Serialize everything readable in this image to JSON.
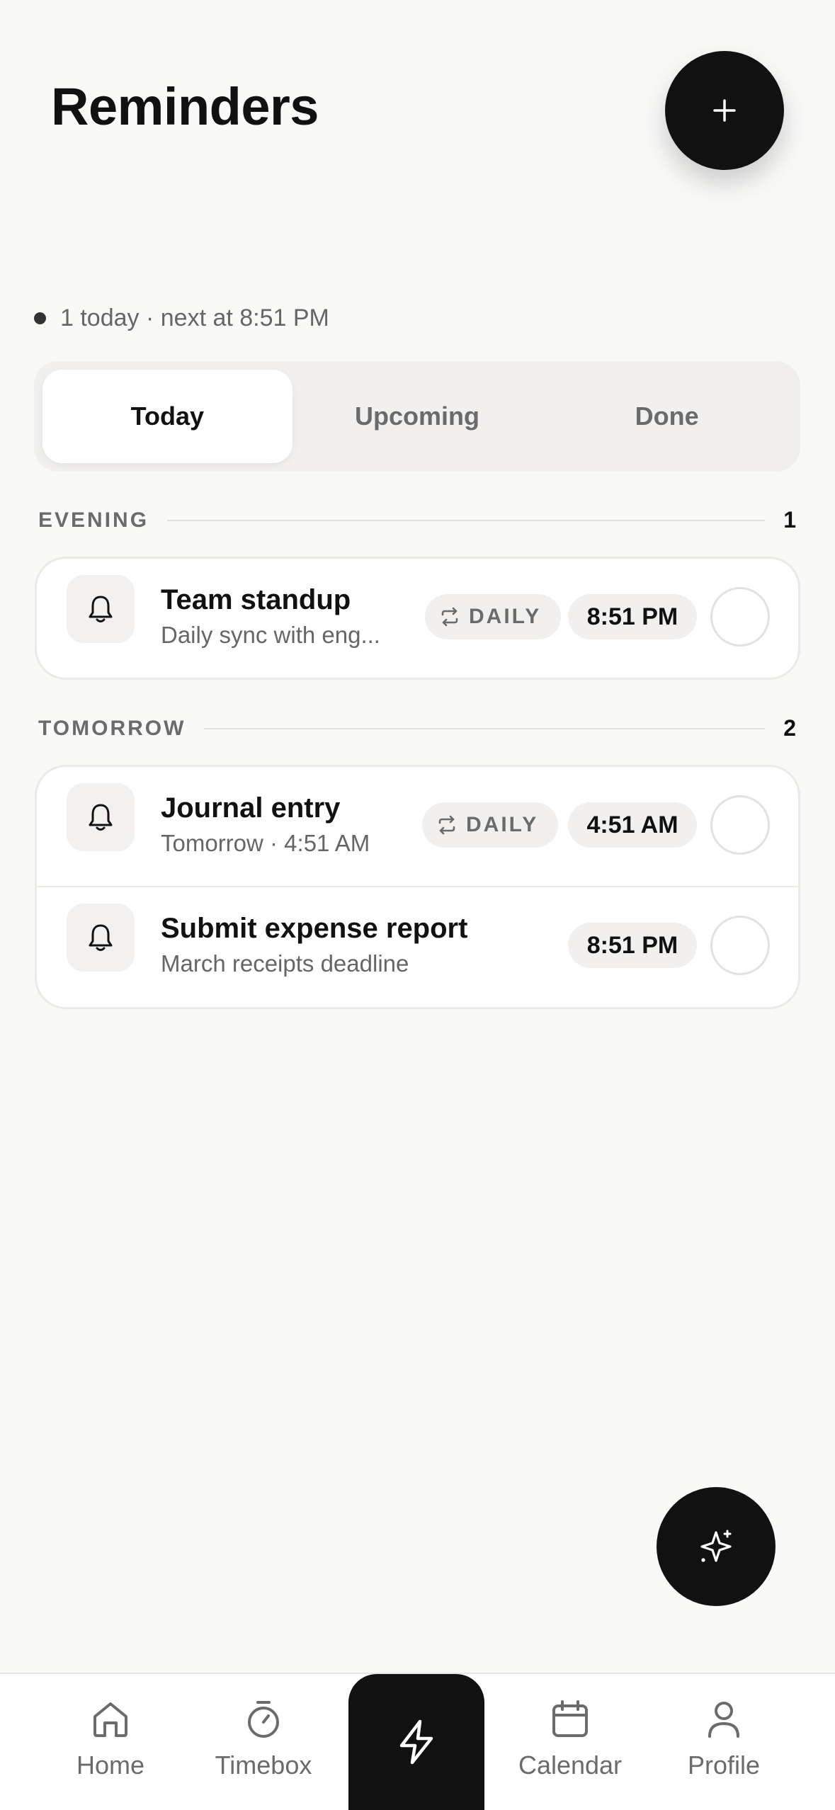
{
  "header": {
    "title": "Reminders"
  },
  "status": {
    "text": "1 today · next at 8:51 PM"
  },
  "segments": [
    {
      "label": "Today",
      "active": true
    },
    {
      "label": "Upcoming",
      "active": false
    },
    {
      "label": "Done",
      "active": false
    }
  ],
  "sections": [
    {
      "label": "EVENING",
      "count": "1",
      "items": [
        {
          "title": "Team standup",
          "subtitle": "Daily sync with eng...",
          "repeat": "DAILY",
          "time": "8:51 PM",
          "icon": "bell-icon"
        }
      ]
    },
    {
      "label": "TOMORROW",
      "count": "2",
      "items": [
        {
          "title": "Journal entry",
          "subtitle": "Tomorrow · 4:51 AM",
          "repeat": "DAILY",
          "time": "4:51 AM",
          "icon": "bell-icon"
        },
        {
          "title": "Submit expense report",
          "subtitle": "March receipts deadline",
          "repeat": "",
          "time": "8:51 PM",
          "icon": "bell-icon"
        }
      ]
    }
  ],
  "tabbar": {
    "items": [
      {
        "label": "Home",
        "icon": "home-icon"
      },
      {
        "label": "Timebox",
        "icon": "stopwatch-icon"
      },
      {
        "label": "",
        "icon": "lightning-icon"
      },
      {
        "label": "Calendar",
        "icon": "calendar-icon"
      },
      {
        "label": "Profile",
        "icon": "person-icon"
      }
    ]
  },
  "colors": {
    "accent": "#111111",
    "background": "#f9f9f8",
    "muted": "#6b6b6b"
  }
}
